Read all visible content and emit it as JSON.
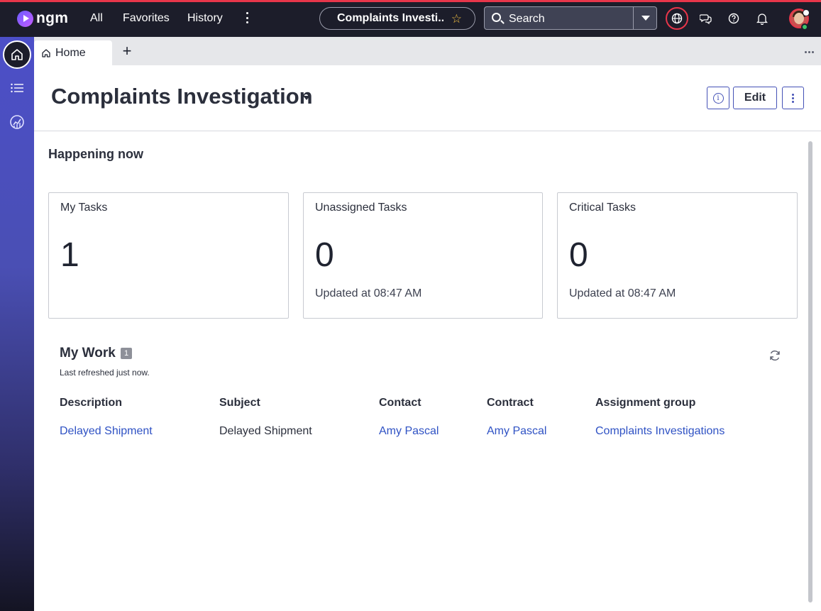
{
  "header": {
    "logo_text": "ngm",
    "nav": {
      "all": "All",
      "favorites": "Favorites",
      "history": "History"
    },
    "workspace_title": "Complaints Investi...",
    "search_label": "Search",
    "accent_color": "#e8364a"
  },
  "tabs": [
    {
      "label": "Home"
    }
  ],
  "page": {
    "title": "Complaints Investigation",
    "edit_label": "Edit"
  },
  "happening_now": {
    "title": "Happening now",
    "cards": [
      {
        "title": "My Tasks",
        "value": "1",
        "updated": ""
      },
      {
        "title": "Unassigned Tasks",
        "value": "0",
        "updated": "Updated at 08:47 AM"
      },
      {
        "title": "Critical Tasks",
        "value": "0",
        "updated": "Updated at 08:47 AM"
      }
    ]
  },
  "my_work": {
    "title": "My Work",
    "count": "1",
    "refreshed": "Last refreshed just now.",
    "columns": [
      "Description",
      "Subject",
      "Contact",
      "Contract",
      "Assignment group"
    ],
    "rows": [
      {
        "description": "Delayed Shipment",
        "subject": "Delayed Shipment",
        "contact": "Amy Pascal",
        "contract": "Amy Pascal",
        "assignment_group": "Complaints Investigations"
      }
    ]
  },
  "icons": {
    "header": [
      "globe-icon",
      "chat-icon",
      "help-icon",
      "bell-icon"
    ],
    "rail": [
      "home-icon",
      "list-icon",
      "dashboard-icon"
    ]
  }
}
